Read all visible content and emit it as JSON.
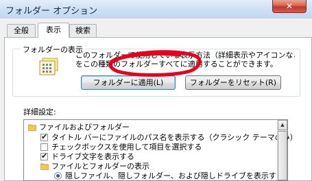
{
  "window": {
    "title": "フォルダー オプション",
    "close_icon": "close-icon"
  },
  "tabs": [
    {
      "label": "全般",
      "active": false
    },
    {
      "label": "表示",
      "active": true
    },
    {
      "label": "検索",
      "active": false
    }
  ],
  "folder_views": {
    "title": "フォルダーの表示",
    "description_line1": "このフォルダーで使用している表示方法（詳細表示やアイコンなど）",
    "description_line2": "をこの種類のフォルダーすべてに適用することができます。",
    "apply_button": "フォルダーに適用(L)",
    "reset_button": "フォルダーをリセット(R)",
    "icon": "folder-view-icon",
    "annotation_color": "#e8001c"
  },
  "advanced": {
    "label": "詳細設定:",
    "items": [
      {
        "type": "folder",
        "label": "ファイルおよびフォルダー"
      },
      {
        "type": "checkbox",
        "label": "タイトル バーにファイルのパス名を表示する（クラシック テーマのみ）",
        "checked": true
      },
      {
        "type": "checkbox",
        "label": "チェックボックスを使用して項目を選択する",
        "checked": false
      },
      {
        "type": "checkbox",
        "label": "ドライブ文字を表示する",
        "checked": true
      },
      {
        "type": "folder",
        "label": "ファイルとフォルダーの表示"
      },
      {
        "type": "radio",
        "label": "隠しファイル、隠しフォルダー、および隠しドライブを表示する",
        "checked": true
      }
    ]
  }
}
